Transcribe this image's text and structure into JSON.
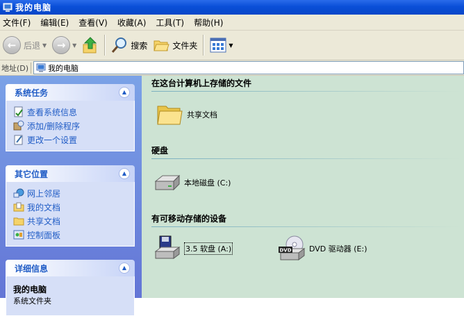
{
  "window": {
    "title": "我的电脑",
    "icon": "computer-icon"
  },
  "menu": [
    "文件(F)",
    "编辑(E)",
    "查看(V)",
    "收藏(A)",
    "工具(T)",
    "帮助(H)"
  ],
  "toolbar": {
    "back_label": "后退",
    "search_label": "搜索",
    "folders_label": "文件夹"
  },
  "address": {
    "label": "地址(D)",
    "value": "我的电脑"
  },
  "tasks": {
    "system": {
      "title": "系统任务",
      "items": [
        "查看系统信息",
        "添加/删除程序",
        "更改一个设置"
      ]
    },
    "other": {
      "title": "其它位置",
      "items": [
        "网上邻居",
        "我的文档",
        "共享文档",
        "控制面板"
      ]
    },
    "details": {
      "title": "详细信息",
      "name": "我的电脑",
      "subtitle": "系统文件夹"
    }
  },
  "content": {
    "groups": [
      {
        "title": "在这台计算机上存储的文件",
        "items": [
          "共享文档"
        ]
      },
      {
        "title": "硬盘",
        "items": [
          "本地磁盘 (C:)"
        ]
      },
      {
        "title": "有可移动存储的设备",
        "items": [
          "3.5 软盘 (A:)",
          "DVD 驱动器 (E:)"
        ]
      }
    ]
  },
  "colors": {
    "title_bar": "#0a4fd8",
    "task_pane": "#6f8ddf",
    "link": "#215dc6",
    "content_bg": "#cde3d3"
  }
}
